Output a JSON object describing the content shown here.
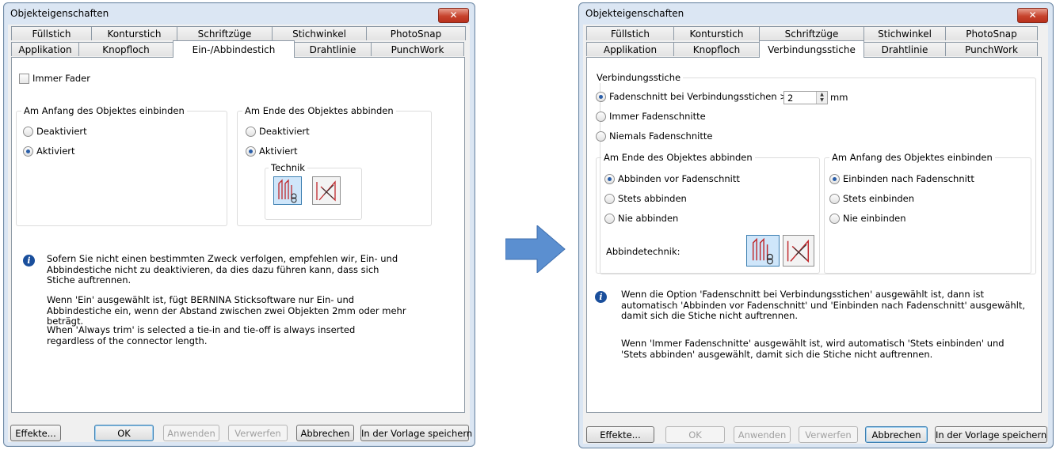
{
  "left": {
    "title": "Objekteigenschaften",
    "tabs_row1": [
      "Füllstich",
      "Konturstich",
      "Schriftzüge",
      "Stichwinkel",
      "PhotoSnap"
    ],
    "tabs_row2": [
      "Applikation",
      "Knopfloch",
      "Ein-/Abbindestich",
      "Drahtlinie",
      "PunchWork"
    ],
    "always_fade_label": "Immer Fader",
    "start_group_label": "Am Anfang des Objektes einbinden",
    "start_opt1": "Deaktiviert",
    "start_opt2": "Aktiviert",
    "end_group_label": "Am Ende des Objektes abbinden",
    "end_opt1": "Deaktiviert",
    "end_opt2": "Aktiviert",
    "technik_label": "Technik",
    "info_p1": "Sofern Sie nicht einen bestimmten Zweck verfolgen, empfehlen wir, Ein- und Abbindestiche nicht zu deaktivieren, da dies dazu führen kann, dass sich Stiche auftrennen.",
    "info_p2": "Wenn 'Ein' ausgewählt ist, fügt BERNINA Sticksoftware nur Ein- und Abbindestiche ein, wenn der Abstand zwischen zwei Objekten 2mm oder mehr beträgt.",
    "info_p3": "When 'Always trim' is selected a tie-in and tie-off is always inserted regardless of the connector length.",
    "buttons": {
      "effekte": "Effekte...",
      "ok": "OK",
      "anwenden": "Anwenden",
      "verwerfen": "Verwerfen",
      "abbrechen": "Abbrechen",
      "vorlage": "In der Vorlage speichern"
    }
  },
  "right": {
    "title": "Objekteigenschaften",
    "tabs_row1": [
      "Füllstich",
      "Konturstich",
      "Schriftzüge",
      "Stichwinkel",
      "PhotoSnap"
    ],
    "tabs_row2": [
      "Applikation",
      "Knopfloch",
      "Verbindungsstiche",
      "Drahtlinie",
      "PunchWork"
    ],
    "group_label": "Verbindungsstiche",
    "opt_trim_label": "Fadenschnitt bei Verbindungsstichen >=",
    "opt_trim_value": "2",
    "opt_trim_unit": "mm",
    "opt_always": "Immer Fadenschnitte",
    "opt_never": "Niemals Fadenschnitte",
    "end_group_label": "Am Ende des Objektes abbinden",
    "end_opt1": "Abbinden vor Fadenschnitt",
    "end_opt2": "Stets abbinden",
    "end_opt3": "Nie abbinden",
    "abbinde_label": "Abbindetechnik:",
    "start_group_label": "Am Anfang des Objektes einbinden",
    "start_opt1": "Einbinden nach Fadenschnitt",
    "start_opt2": "Stets einbinden",
    "start_opt3": "Nie einbinden",
    "info_p1": "Wenn die Option 'Fadenschnitt bei Verbindungsstichen' ausgewählt ist, dann ist automatisch 'Abbinden vor Fadenschnitt' und 'Einbinden nach Fadenschnitt' ausgewählt, damit sich die Stiche nicht auftrennen.",
    "info_p2": "Wenn 'Immer Fadenschnitte' ausgewählt ist, wird automatisch 'Stets einbinden' und 'Stets abbinden' ausgewählt, damit sich die Stiche nicht auftrennen.",
    "buttons": {
      "effekte": "Effekte...",
      "ok": "OK",
      "anwenden": "Anwenden",
      "verwerfen": "Verwerfen",
      "abbrechen": "Abbrechen",
      "vorlage": "In der Vorlage speichern"
    }
  },
  "icons": {
    "close": "close-icon",
    "info": "info-icon",
    "arrow": "right-arrow-icon",
    "tieoff_selected": "tie-off-technique-icon",
    "tieoff_alt": "tie-off-alt-technique-icon"
  },
  "colors": {
    "arrow": "#5b8fd0",
    "frame": "#dbe6f3",
    "close": "#c7432d"
  }
}
